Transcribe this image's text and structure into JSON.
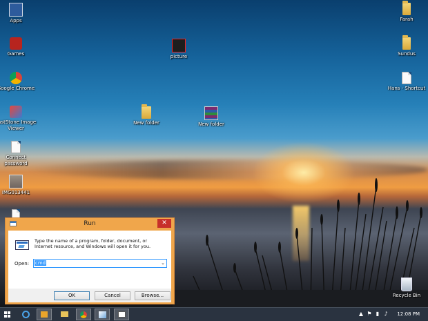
{
  "desktop": {
    "icons_left": [
      {
        "label": "Apps",
        "icon": "apps-icon"
      },
      {
        "label": "Games",
        "icon": "games-icon"
      },
      {
        "label": "Google Chrome",
        "icon": "chrome-icon"
      },
      {
        "label": "FastStone Image Viewer",
        "icon": "faststone-icon"
      },
      {
        "label": "Connect password",
        "icon": "document-icon"
      },
      {
        "label": "IMG013441",
        "icon": "image-icon"
      }
    ],
    "icons_center": [
      {
        "label": "picture",
        "icon": "picture-icon"
      },
      {
        "label": "New folder",
        "icon": "folder-icon"
      },
      {
        "label": "New folder",
        "icon": "winrar-icon"
      }
    ],
    "icons_right": [
      {
        "label": "Farah",
        "icon": "folder-icon"
      },
      {
        "label": "Sundus",
        "icon": "folder-icon"
      },
      {
        "label": "Hans - Shortcut",
        "icon": "shortcut-icon"
      },
      {
        "label": "Recycle Bin",
        "icon": "recycle-bin-icon"
      }
    ]
  },
  "run_dialog": {
    "title": "Run",
    "close_label": "✕",
    "description": "Type the name of a program, folder, document, or Internet resource, and Windows will open it for you.",
    "open_label": "Open:",
    "open_value": "cmd",
    "buttons": {
      "ok": "OK",
      "cancel": "Cancel",
      "browse": "Browse..."
    }
  },
  "taskbar": {
    "clock": "12:08 PM",
    "items": [
      "start-icon",
      "internet-explorer-icon",
      "media-player-icon",
      "file-explorer-icon",
      "chrome-icon",
      "paint-icon",
      "run-icon"
    ]
  },
  "colors": {
    "run_frame": "#f0a64b",
    "close": "#c7302a",
    "taskbar": "#2a3340"
  }
}
